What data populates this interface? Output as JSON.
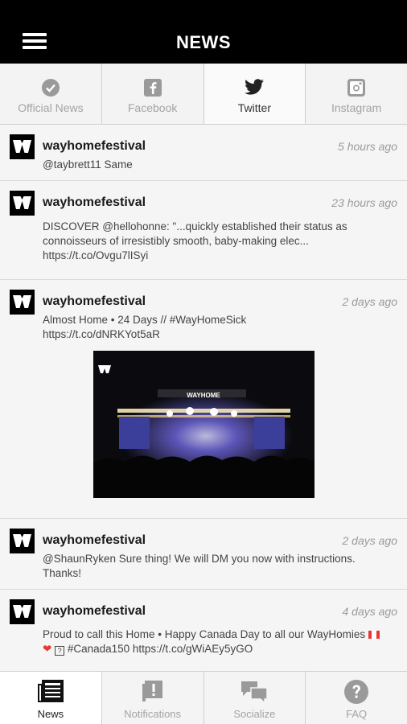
{
  "header": {
    "title": "NEWS",
    "menu_icon": "hamburger-icon"
  },
  "tabs": [
    {
      "label": "Official News",
      "icon": "check-circle-icon",
      "active": false
    },
    {
      "label": "Facebook",
      "icon": "facebook-icon",
      "active": false
    },
    {
      "label": "Twitter",
      "icon": "twitter-icon",
      "active": true
    },
    {
      "label": "Instagram",
      "icon": "instagram-icon",
      "active": false
    }
  ],
  "posts": [
    {
      "user": "wayhomefestival",
      "time": "5 hours ago",
      "text": "@taybrett11 Same"
    },
    {
      "user": "wayhomefestival",
      "time": "23 hours ago",
      "text": "DISCOVER @hellohonne: \"...quickly established their status as connoisseurs of irresistibly smooth, baby-making elec... https://t.co/Ovgu7lISyi"
    },
    {
      "user": "wayhomefestival",
      "time": "2 days ago",
      "text": "Almost Home • 24 Days // #WayHomeSick https://t.co/dNRKYot5aR",
      "image_text": "WAYHOME"
    },
    {
      "user": "wayhomefestival",
      "time": "2 days ago",
      "text": "@ShaunRyken Sure thing! We will DM you now with instructions. Thanks!"
    },
    {
      "user": "wayhomefestival",
      "time": "4 days ago",
      "text_before": "Proud to call this Home • Happy Canada Day to all our WayHomies",
      "text_after": "#Canada150 https://t.co/gWiAEy5yGO"
    }
  ],
  "bottom_nav": [
    {
      "label": "News",
      "icon": "newspaper-icon",
      "active": true
    },
    {
      "label": "Notifications",
      "icon": "alert-icon",
      "active": false
    },
    {
      "label": "Socialize",
      "icon": "chat-icon",
      "active": false
    },
    {
      "label": "FAQ",
      "icon": "help-icon",
      "active": false
    }
  ],
  "colors": {
    "header_bg": "#000000",
    "muted_text": "#a3a3a3",
    "feed_bg": "#f5f5f5"
  }
}
